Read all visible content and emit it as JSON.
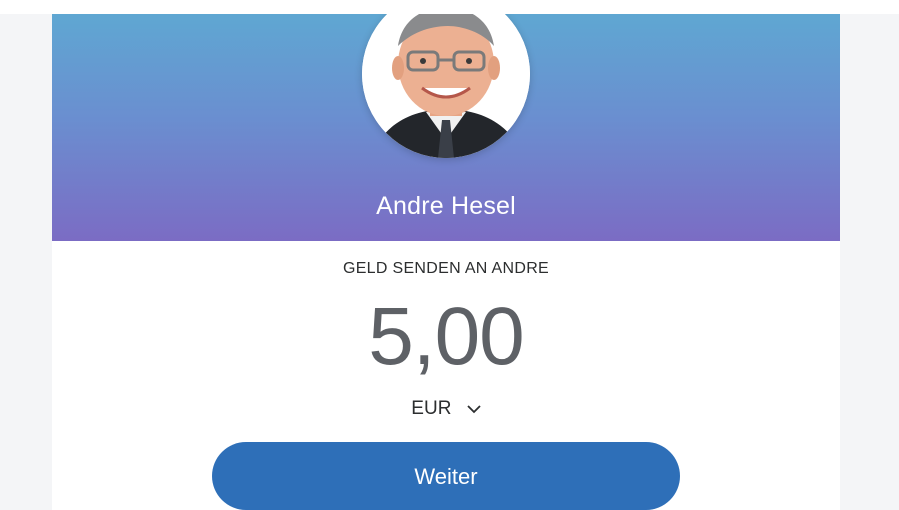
{
  "recipient": {
    "name": "Andre Hesel",
    "avatar_icon": "profile-photo"
  },
  "send": {
    "label": "GELD SENDEN AN ANDRE",
    "amount": "5,00",
    "currency": "EUR"
  },
  "actions": {
    "continue_label": "Weiter"
  },
  "colors": {
    "header_top": "#5fa7d2",
    "header_bottom": "#7b6cc4",
    "button": "#2e6fb8"
  }
}
